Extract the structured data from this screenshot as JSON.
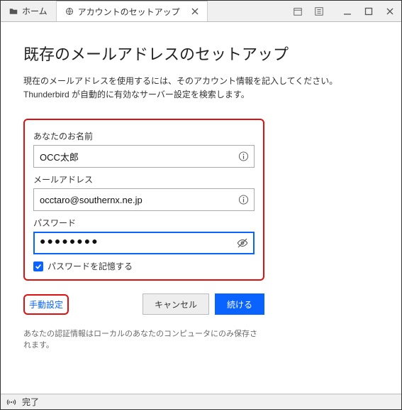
{
  "titlebar": {
    "tab_home": "ホーム",
    "tab_setup": "アカウントのセットアップ"
  },
  "heading": "既存のメールアドレスのセットアップ",
  "description_line1": "現在のメールアドレスを使用するには、そのアカウント情報を記入してください。",
  "description_line2": "Thunderbird が自動的に有効なサーバー設定を検索します。",
  "form": {
    "name_label": "あなたのお名前",
    "name_value": "OCC太郎",
    "email_label": "メールアドレス",
    "email_value": "occtaro@southernx.ne.jp",
    "password_label": "パスワード",
    "password_value": "●●●●●●●●",
    "remember_label": "パスワードを記憶する"
  },
  "actions": {
    "manual": "手動設定",
    "cancel": "キャンセル",
    "continue": "続ける"
  },
  "note": "あなたの認証情報はローカルのあなたのコンピュータにのみ保存されます。",
  "statusbar": {
    "text": "完了"
  }
}
